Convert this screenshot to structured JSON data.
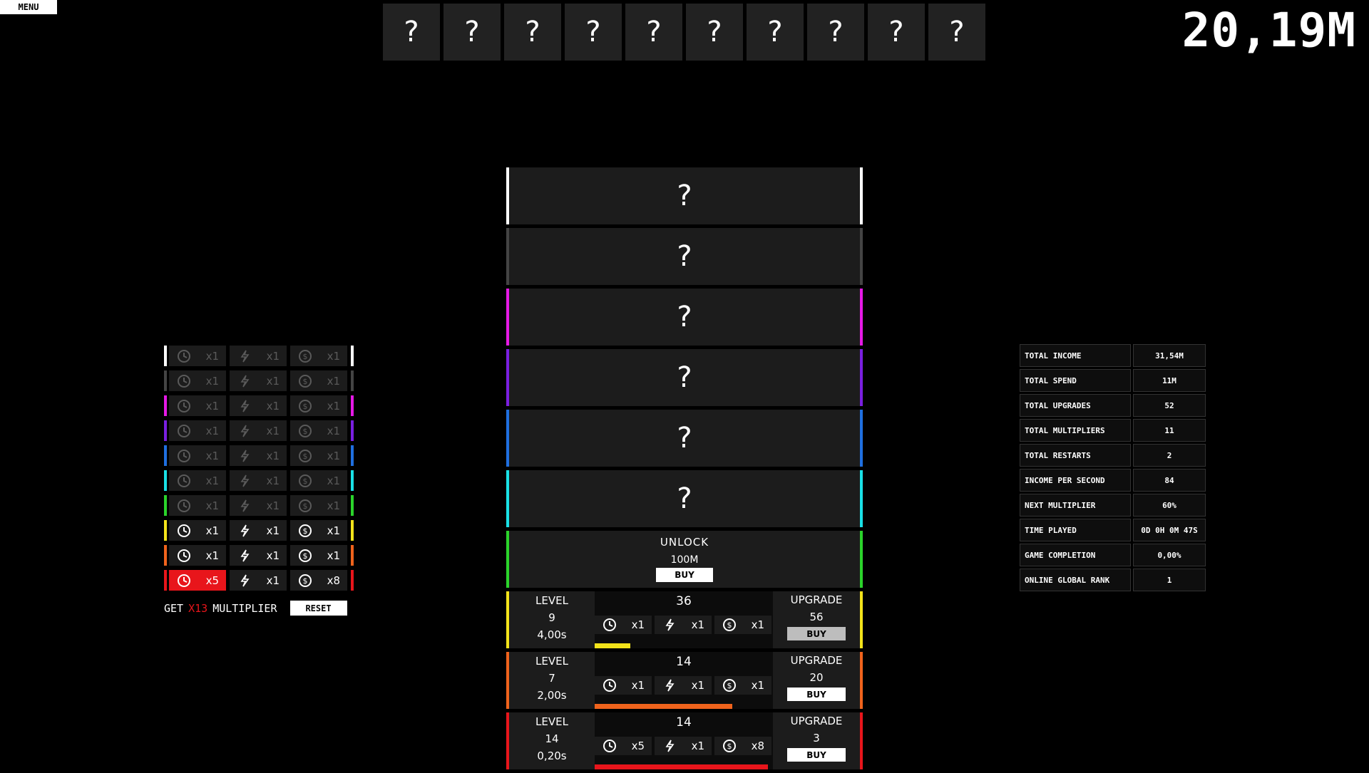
{
  "menu_label": "MENU",
  "balance": "20,19M",
  "top_slots": [
    "?",
    "?",
    "?",
    "?",
    "?",
    "?",
    "?",
    "?",
    "?",
    "?"
  ],
  "locked_levels": [
    {
      "label": "?",
      "color": "#ffffff"
    },
    {
      "label": "?",
      "color": "#444444"
    },
    {
      "label": "?",
      "color": "#e619e6"
    },
    {
      "label": "?",
      "color": "#7a1fe0"
    },
    {
      "label": "?",
      "color": "#1f6fe0"
    },
    {
      "label": "?",
      "color": "#19e0e6"
    }
  ],
  "unlock": {
    "title": "UNLOCK",
    "cost": "100M",
    "buy_label": "BUY",
    "color": "#2bd42b"
  },
  "active_levels": [
    {
      "level_label": "LEVEL",
      "level": "9",
      "time": "4,00s",
      "cost": "36",
      "mults": [
        "x1",
        "x1",
        "x1"
      ],
      "upgrade_label": "UPGRADE",
      "upgrade_cost": "56",
      "buy_label": "BUY",
      "color": "#f3e31a",
      "progress": 0.2
    },
    {
      "level_label": "LEVEL",
      "level": "7",
      "time": "2,00s",
      "cost": "14",
      "mults": [
        "x1",
        "x1",
        "x1"
      ],
      "upgrade_label": "UPGRADE",
      "upgrade_cost": "20",
      "buy_label": "BUY",
      "color": "#f0631c",
      "progress": 0.77
    },
    {
      "level_label": "LEVEL",
      "level": "14",
      "time": "0,20s",
      "cost": "14",
      "mults": [
        "x5",
        "x1",
        "x8"
      ],
      "upgrade_label": "UPGRADE",
      "upgrade_cost": "3",
      "buy_label": "BUY",
      "color": "#e8151b",
      "progress": 0.97
    }
  ],
  "multiplier_panel": [
    {
      "color": "#ffffff",
      "values": [
        "x1",
        "x1",
        "x1"
      ],
      "state": "dim"
    },
    {
      "color": "#444444",
      "values": [
        "x1",
        "x1",
        "x1"
      ],
      "state": "dim"
    },
    {
      "color": "#e619e6",
      "values": [
        "x1",
        "x1",
        "x1"
      ],
      "state": "dim"
    },
    {
      "color": "#7a1fe0",
      "values": [
        "x1",
        "x1",
        "x1"
      ],
      "state": "dim"
    },
    {
      "color": "#1f6fe0",
      "values": [
        "x1",
        "x1",
        "x1"
      ],
      "state": "dim"
    },
    {
      "color": "#19e0e6",
      "values": [
        "x1",
        "x1",
        "x1"
      ],
      "state": "dim"
    },
    {
      "color": "#2bd42b",
      "values": [
        "x1",
        "x1",
        "x1"
      ],
      "state": "dim"
    },
    {
      "color": "#f3e31a",
      "values": [
        "x1",
        "x1",
        "x1"
      ],
      "state": "active"
    },
    {
      "color": "#f0631c",
      "values": [
        "x1",
        "x1",
        "x1"
      ],
      "state": "active"
    },
    {
      "color": "#e8151b",
      "values": [
        "x5",
        "x1",
        "x8"
      ],
      "state": "active",
      "highlight_first": true
    }
  ],
  "get_multiplier": {
    "prefix": "GET",
    "value": "X13",
    "suffix": "MULTIPLIER",
    "reset_label": "RESET"
  },
  "stats": [
    {
      "label": "TOTAL INCOME",
      "value": "31,54M"
    },
    {
      "label": "TOTAL SPEND",
      "value": "11M"
    },
    {
      "label": "TOTAL UPGRADES",
      "value": "52"
    },
    {
      "label": "TOTAL MULTIPLIERS",
      "value": "11"
    },
    {
      "label": "TOTAL RESTARTS",
      "value": "2"
    },
    {
      "label": "INCOME PER SECOND",
      "value": "84"
    },
    {
      "label": "NEXT MULTIPLIER",
      "value": "60%"
    },
    {
      "label": "TIME PLAYED",
      "value": "0D 0H 0M 47S"
    },
    {
      "label": "GAME COMPLETION",
      "value": "0,00%"
    },
    {
      "label": "ONLINE GLOBAL RANK",
      "value": "1"
    }
  ],
  "icons": [
    "clock-icon",
    "bolt-icon",
    "coin-icon"
  ]
}
